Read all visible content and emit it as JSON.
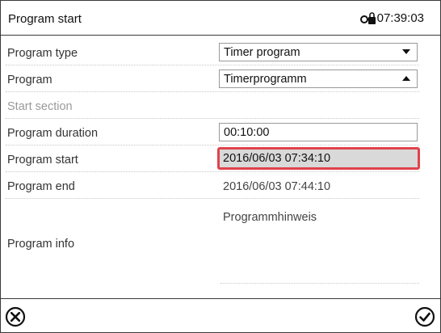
{
  "header": {
    "title": "Program start",
    "time": "07:39:03",
    "lock_icon": "lock-icon"
  },
  "rows": {
    "program_type": {
      "label": "Program type",
      "value": "Timer program"
    },
    "program": {
      "label": "Program",
      "value": "Timerprogramm"
    },
    "start_section": {
      "label": "Start section"
    },
    "program_duration": {
      "label": "Program duration",
      "value": "00:10:00"
    },
    "program_start": {
      "label": "Program start",
      "value": "2016/06/03 07:34:10"
    },
    "program_end": {
      "label": "Program end",
      "value": "2016/06/03 07:44:10"
    },
    "program_info": {
      "label": "Program info",
      "value": "Programmhinweis"
    }
  },
  "footer": {
    "cancel_icon": "cancel-icon",
    "confirm_icon": "confirm-icon"
  },
  "colors": {
    "highlight_border": "#e0434c",
    "highlight_fill": "#d9d9d9"
  }
}
